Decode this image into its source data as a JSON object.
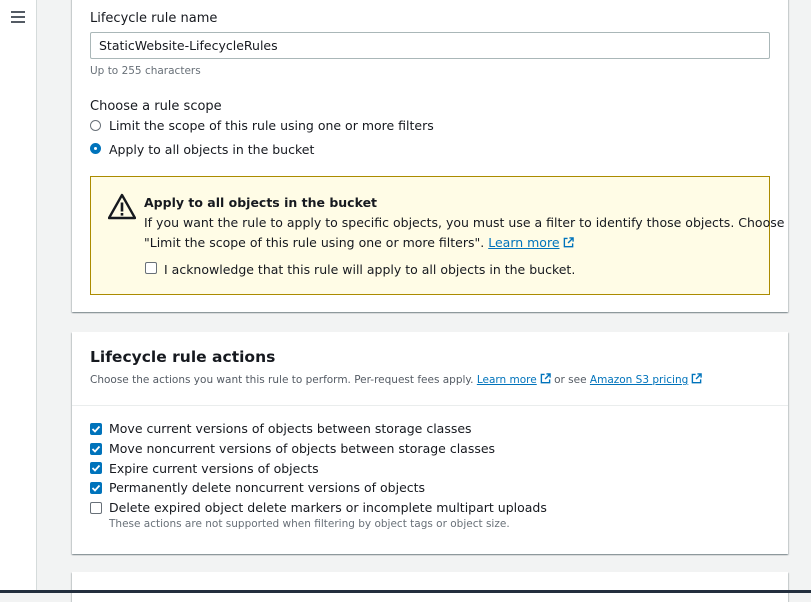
{
  "form": {
    "rule_name_label": "Lifecycle rule name",
    "rule_name_value": "StaticWebsite-LifecycleRules",
    "rule_name_hint": "Up to 255 characters",
    "scope_label": "Choose a rule scope",
    "scope_options": [
      {
        "label": "Limit the scope of this rule using one or more filters",
        "selected": false
      },
      {
        "label": "Apply to all objects in the bucket",
        "selected": true
      }
    ]
  },
  "alert": {
    "title": "Apply to all objects in the bucket",
    "line1": "If you want the rule to apply to specific objects, you must use a filter to identify those objects. Choose",
    "line2": "\"Limit the scope of this rule using one or more filters\".",
    "learn_more": "Learn more",
    "acknowledge_label": "I acknowledge that this rule will apply to all objects in the bucket.",
    "acknowledge_checked": false
  },
  "actions": {
    "title": "Lifecycle rule actions",
    "description": "Choose the actions you want this rule to perform. Per-request fees apply.",
    "learn_more": "Learn more",
    "or_see": "or see",
    "pricing_link": "Amazon S3 pricing",
    "items": [
      {
        "label": "Move current versions of objects between storage classes",
        "checked": true
      },
      {
        "label": "Move noncurrent versions of objects between storage classes",
        "checked": true
      },
      {
        "label": "Expire current versions of objects",
        "checked": true
      },
      {
        "label": "Permanently delete noncurrent versions of objects",
        "checked": true
      },
      {
        "label": "Delete expired object delete markers or incomplete multipart uploads",
        "checked": false
      }
    ],
    "last_item_note": "These actions are not supported when filtering by object tags or object size."
  },
  "colors": {
    "accent": "#0073bb",
    "warning_bg": "#fffce6",
    "warning_border": "#ab8b00"
  }
}
